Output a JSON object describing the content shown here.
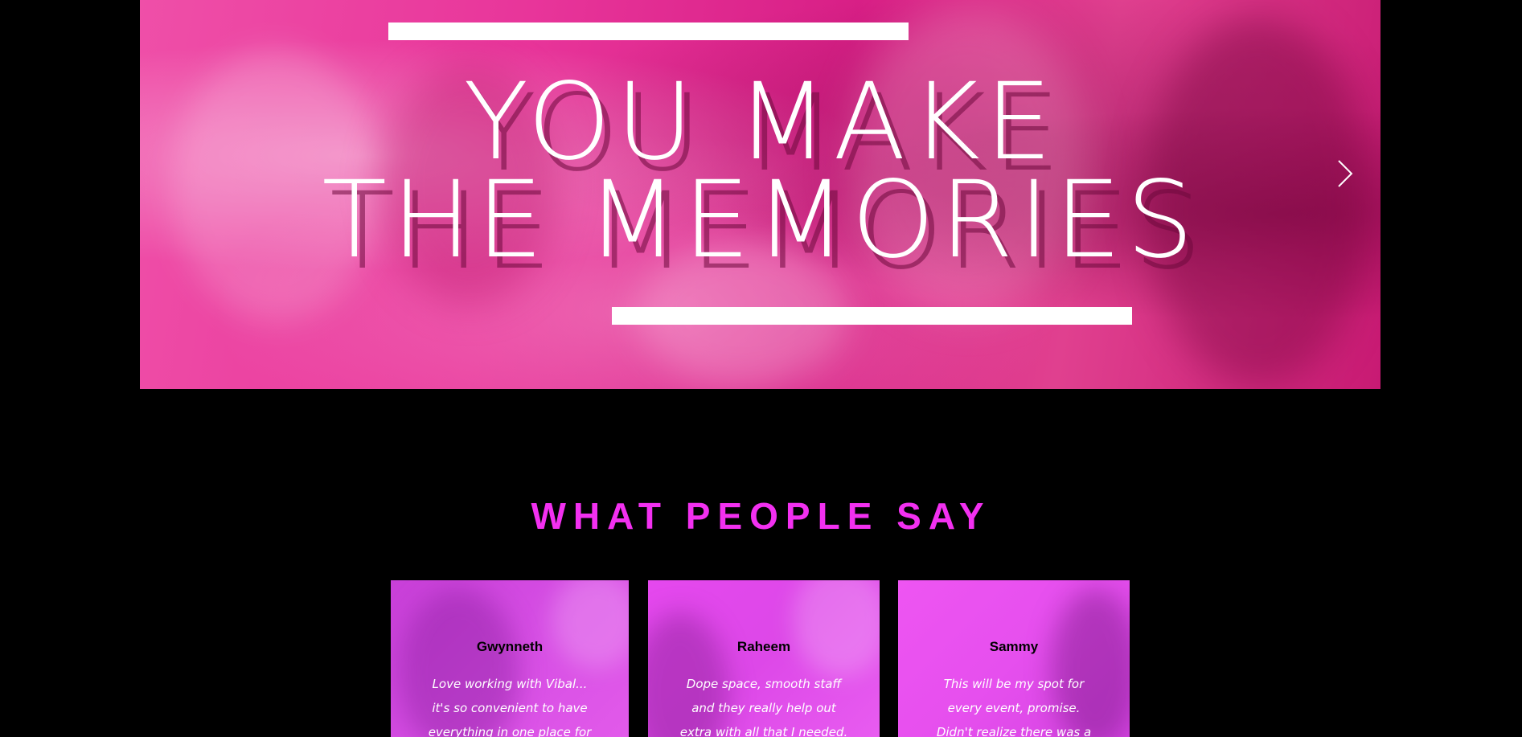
{
  "hero": {
    "line1": "YOU MAKE",
    "line2": "THE MEMORIES",
    "next_arrow_icon": "chevron-right-icon",
    "accent": "#e8359a"
  },
  "testimonials": {
    "heading": "WHAT PEOPLE SAY",
    "heading_color": "#f230f0",
    "items": [
      {
        "name": "Gwynneth",
        "quote_lines": [
          "Love working with Vibal...",
          "it's so convenient to have",
          "everything in one place for"
        ]
      },
      {
        "name": "Raheem",
        "quote_lines": [
          "Dope space, smooth staff",
          "and they really help out",
          "extra with all that I needed."
        ]
      },
      {
        "name": "Sammy",
        "quote_lines": [
          "This will be my spot for",
          "every event, promise.",
          "Didn't  realize there was a"
        ]
      }
    ]
  }
}
